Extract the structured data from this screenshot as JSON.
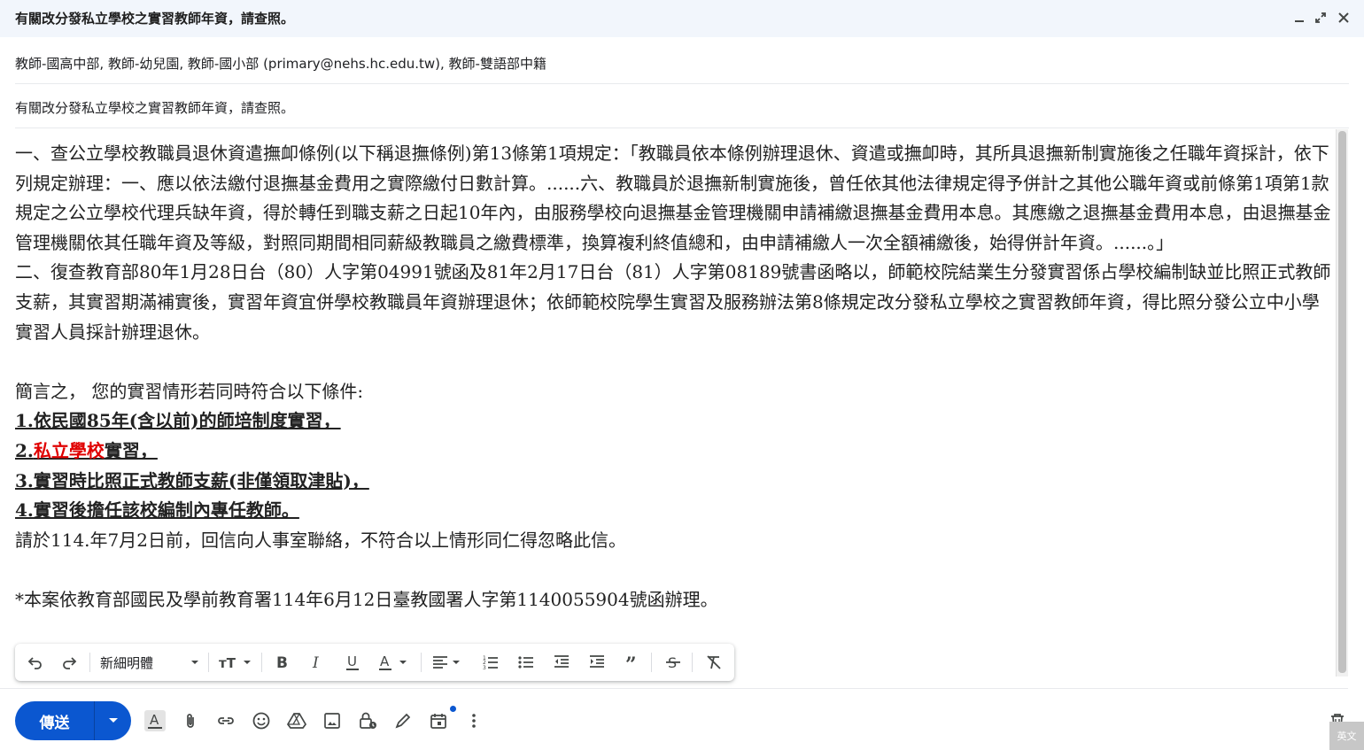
{
  "window": {
    "title": "有關改分發私立學校之實習教師年資，請查照。",
    "buttons": {
      "minimize": "minimize-icon",
      "expand": "expand-icon",
      "close": "close-icon"
    }
  },
  "header": {
    "recipients": "教師-國高中部, 教師-幼兒園, 教師-國小部 (primary@nehs.hc.edu.tw), 教師-雙語部中籍",
    "subject": "有關改分發私立學校之實習教師年資，請查照。"
  },
  "body": {
    "para1": "一、查公立學校教職員退休資遣撫卹條例(以下稱退撫條例)第13條第1項規定：「教職員依本條例辦理退休、資遣或撫卹時，其所具退撫新制實施後之任職年資採計，依下列規定辦理：一、應以依法繳付退撫基金費用之實際繳付日數計算。......六、教職員於退撫新制實施後，曾任依其他法律規定得予併計之其他公職年資或前條第1項第1款規定之公立學校代理兵缺年資，得於轉任到職支薪之日起10年內，由服務學校向退撫基金管理機關申請補繳退撫基金費用本息。其應繳之退撫基金費用本息，由退撫基金管理機關依其任職年資及等級，對照同期間相同薪級教職員之繳費標準，換算複利終值總和，由申請補繳人一次全額補繳後，始得併計年資。......。」",
    "para2": "二、復查教育部80年1月28日台（80）人字第04991號函及81年2月17日台（81）人字第08189號書函略以，師範校院結業生分發實習係占學校編制缺並比照正式教師支薪，其實習期滿補實後，實習年資宜併學校教職員年資辦理退休；依師範校院學生實習及服務辦法第8條規定改分發私立學校之實習教師年資，得比照分發公立中小學實習人員採計辦理退休。",
    "summary": "簡言之， 您的實習情形若同時符合以下條件:",
    "cond1": "1.依民國85年(含以前)的師培制度實習，",
    "cond2_prefix": "2.",
    "cond2_red": "私立學校",
    "cond2_suffix": "實習，",
    "cond3": "3.實習時比照正式教師支薪(非僅領取津貼)，",
    "cond4": "4.實習後擔任該校編制內專任教師。",
    "reply": "請於114.年7月2日前，回信向人事室聯絡，不符合以上情形同仁得忽略此信。",
    "note": "*本案依教育部國民及學前教育署114年6月12日臺教國署人字第1140055904號函辦理。",
    "highlight_color": "#e00000"
  },
  "format_toolbar": {
    "font": "新細明體",
    "icons": [
      "undo-icon",
      "redo-icon",
      "font-size-icon",
      "bold-icon",
      "italic-icon",
      "underline-icon",
      "text-color-icon",
      "align-icon",
      "numbered-list-icon",
      "bulleted-list-icon",
      "indent-less-icon",
      "indent-more-icon",
      "quote-icon",
      "strikethrough-icon",
      "remove-formatting-icon"
    ]
  },
  "bottom_bar": {
    "send_label": "傳送",
    "icons": [
      "formatting-options-icon",
      "attach-icon",
      "link-icon",
      "emoji-icon",
      "drive-icon",
      "photo-icon",
      "confidential-icon",
      "signature-icon",
      "schedule-icon",
      "more-options-icon",
      "trash-icon"
    ]
  },
  "ime_indicator": "英文",
  "colors": {
    "accent": "#0b57d0",
    "titlebar_bg": "#f2f6fc"
  }
}
